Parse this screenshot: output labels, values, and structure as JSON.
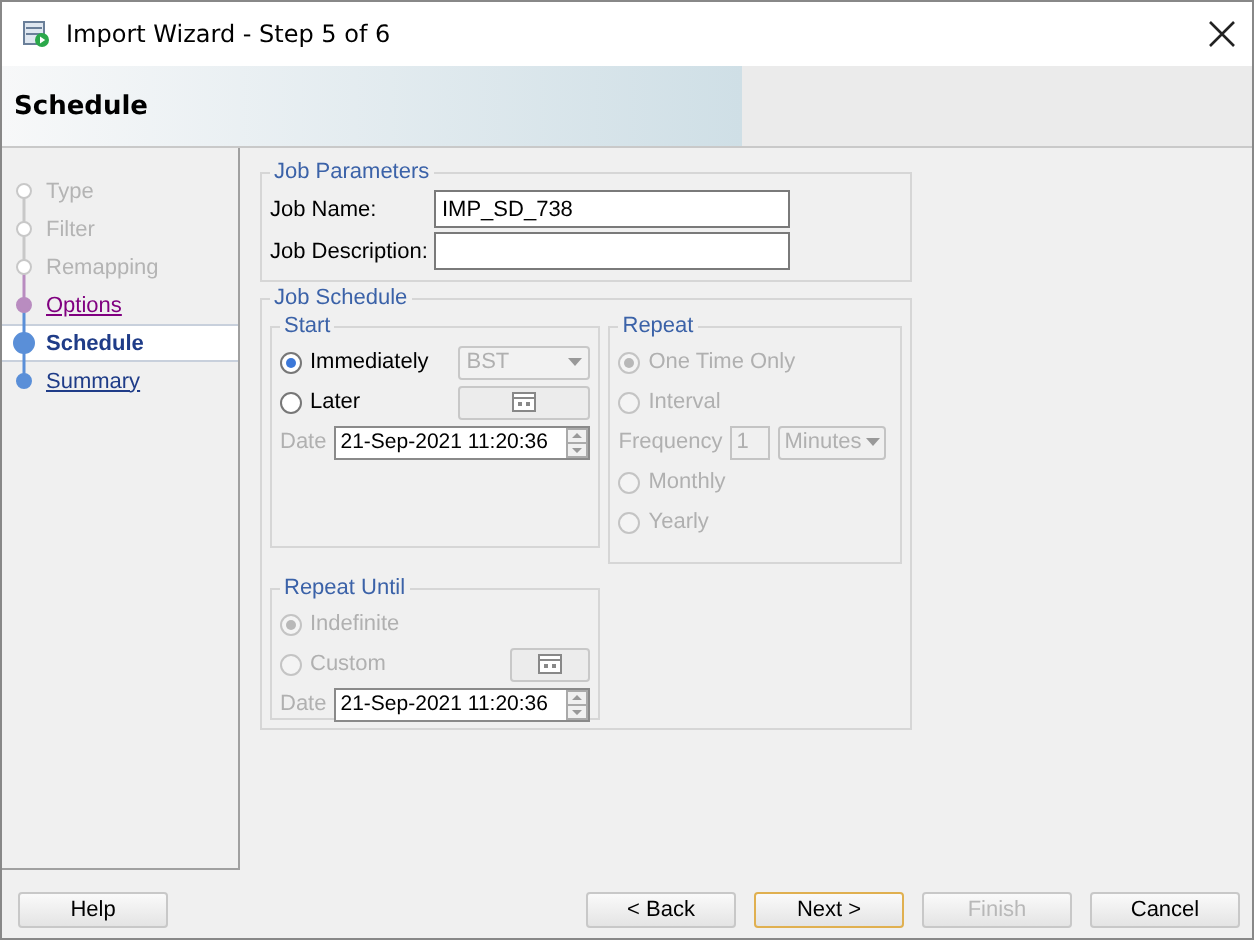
{
  "window": {
    "title": "Import Wizard - Step 5 of 6"
  },
  "header": {
    "title": "Schedule"
  },
  "steps": [
    {
      "label": "Type",
      "kind": "disabled",
      "selected": false
    },
    {
      "label": "Filter",
      "kind": "disabled",
      "selected": false
    },
    {
      "label": "Remapping",
      "kind": "disabled",
      "selected": false
    },
    {
      "label": "Options",
      "kind": "visited",
      "selected": false
    },
    {
      "label": "Schedule",
      "kind": "current",
      "selected": true
    },
    {
      "label": "Summary",
      "kind": "link",
      "selected": false
    }
  ],
  "job_parameters": {
    "title": "Job Parameters",
    "fields": [
      {
        "label": "Job Name:",
        "value": "IMP_SD_738"
      },
      {
        "label": "Job Description:"
      }
    ]
  },
  "job_schedule": {
    "title": "Job Schedule",
    "start": {
      "title": "Start",
      "options": [
        {
          "label": "Immediately",
          "selected": true,
          "disabled": false
        },
        {
          "label": "Later",
          "selected": false,
          "disabled": false
        }
      ],
      "timezone": {
        "value": "BST",
        "disabled": true
      },
      "date": {
        "label": "Date",
        "value": "21-Sep-2021 11:20:36",
        "disabled": true
      }
    },
    "repeat": {
      "title": "Repeat",
      "items": [
        {
          "kind": "radio",
          "label": "One Time Only",
          "selected": true,
          "disabled": true
        },
        {
          "kind": "radio",
          "label": "Interval",
          "selected": false,
          "disabled": true
        },
        {
          "kind": "frequency",
          "label": "Frequency",
          "value": "1",
          "unit": "Minutes",
          "disabled": true
        },
        {
          "kind": "radio",
          "label": "Monthly",
          "selected": false,
          "disabled": true
        },
        {
          "kind": "radio",
          "label": "Yearly",
          "selected": false,
          "disabled": true
        }
      ]
    },
    "repeat_until": {
      "title": "Repeat Until",
      "options": [
        {
          "label": "Indefinite",
          "selected": true,
          "disabled": true
        },
        {
          "label": "Custom",
          "selected": false,
          "disabled": true
        }
      ],
      "date": {
        "label": "Date",
        "value": "21-Sep-2021 11:20:36",
        "disabled": true
      }
    }
  },
  "buttons": [
    {
      "label": "Help",
      "default": false,
      "disabled": false
    },
    {
      "label": "< Back",
      "default": false,
      "disabled": false
    },
    {
      "label": "Next >",
      "default": true,
      "disabled": false
    },
    {
      "label": "Finish",
      "default": false,
      "disabled": true
    },
    {
      "label": "Cancel",
      "default": false,
      "disabled": false
    }
  ]
}
